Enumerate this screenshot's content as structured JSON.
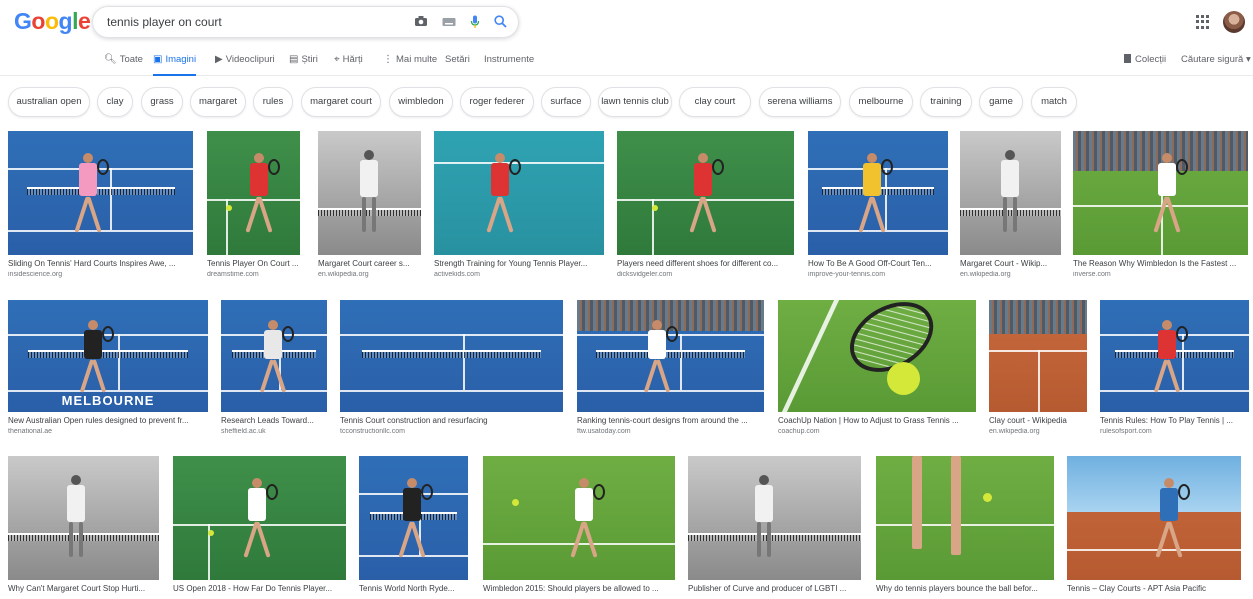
{
  "header": {
    "logo_letters": [
      {
        "ch": "G",
        "color": "#4285f4"
      },
      {
        "ch": "o",
        "color": "#ea4335"
      },
      {
        "ch": "o",
        "color": "#fbbc05"
      },
      {
        "ch": "g",
        "color": "#4285f4"
      },
      {
        "ch": "l",
        "color": "#34a853"
      },
      {
        "ch": "e",
        "color": "#ea4335"
      }
    ],
    "query": "tennis player on court",
    "icons": [
      "camera-icon",
      "keyboard-icon",
      "mic-icon",
      "search-icon"
    ]
  },
  "tabs": [
    {
      "label": "Toate",
      "icon": "search-icon",
      "active": false
    },
    {
      "label": "Imagini",
      "icon": "image-icon",
      "active": true
    },
    {
      "label": "Videoclipuri",
      "icon": "video-icon",
      "active": false
    },
    {
      "label": "Știri",
      "icon": "news-icon",
      "active": false
    },
    {
      "label": "Hărți",
      "icon": "map-icon",
      "active": false
    },
    {
      "label": "Mai multe",
      "icon": "more-icon",
      "active": false
    },
    {
      "label": "Setări",
      "icon": "",
      "active": false
    },
    {
      "label": "Instrumente",
      "icon": "",
      "active": false
    }
  ],
  "right_tools": {
    "collections": "Colecții",
    "safe_search": "Căutare sigură"
  },
  "chips": [
    "australian open",
    "clay",
    "grass",
    "margaret",
    "rules",
    "margaret court",
    "wimbledon",
    "roger federer",
    "surface",
    "lawn tennis club",
    "clay court",
    "serena williams",
    "melbourne",
    "training",
    "game",
    "match"
  ],
  "results": [
    {
      "title": "Sliding On Tennis' Hard Courts Inspires Awe, ...",
      "source": "insidescience.org",
      "scene": "blue-player"
    },
    {
      "title": "Tennis Player On Court ...",
      "source": "dreamstime.com",
      "scene": "green-player"
    },
    {
      "title": "Margaret Court career s...",
      "source": "en.wikipedia.org",
      "scene": "bw-player"
    },
    {
      "title": "Strength Training for Young Tennis Player...",
      "source": "activekids.com",
      "scene": "teal-player"
    },
    {
      "title": "Players need different shoes for different co...",
      "source": "dicksvidgeler.com",
      "scene": "green-player"
    },
    {
      "title": "How To Be A Good Off-Court Ten...",
      "source": "improve-your-tennis.com",
      "scene": "blue-player"
    },
    {
      "title": "Margaret Court - Wikip...",
      "source": "en.wikipedia.org",
      "scene": "bw-player"
    },
    {
      "title": "The Reason Why Wimbledon Is the Fastest ...",
      "source": "inverse.com",
      "scene": "grass-stands"
    },
    {
      "title": "New Australian Open rules designed to prevent fr...",
      "source": "thenational.ae",
      "scene": "blue-melbourne"
    },
    {
      "title": "Research Leads Toward...",
      "source": "sheffield.ac.uk",
      "scene": "blue-player"
    },
    {
      "title": "Tennis Court construction and resurfacing",
      "source": "tcconstructionllc.com",
      "scene": "blue-court"
    },
    {
      "title": "Ranking tennis-court designs from around the ...",
      "source": "ftw.usatoday.com",
      "scene": "blue-stadium"
    },
    {
      "title": "CoachUp Nation | How to Adjust to Grass Tennis ...",
      "source": "coachup.com",
      "scene": "racket-ball"
    },
    {
      "title": "Clay court - Wikipedia",
      "source": "en.wikipedia.org",
      "scene": "clay-court"
    },
    {
      "title": "Tennis Rules: How To Play Tennis | ...",
      "source": "rulesofsport.com",
      "scene": "blue-player"
    },
    {
      "title": "Why Can't Margaret Court Stop Hurti...",
      "source": "",
      "scene": "bw-player"
    },
    {
      "title": "US Open 2018 - How Far Do Tennis Player...",
      "source": "",
      "scene": "green-player"
    },
    {
      "title": "Tennis World North Ryde...",
      "source": "",
      "scene": "blue-player"
    },
    {
      "title": "Wimbledon 2015: Should players be allowed to ...",
      "source": "",
      "scene": "grass-player"
    },
    {
      "title": "Publisher of Curve and producer of LGBTI ...",
      "source": "",
      "scene": "bw-player"
    },
    {
      "title": "Why do tennis players bounce the ball befor...",
      "source": "",
      "scene": "grass-legs"
    },
    {
      "title": "Tennis – Clay Courts - APT Asia Pacific",
      "source": "",
      "scene": "clay-player"
    }
  ]
}
